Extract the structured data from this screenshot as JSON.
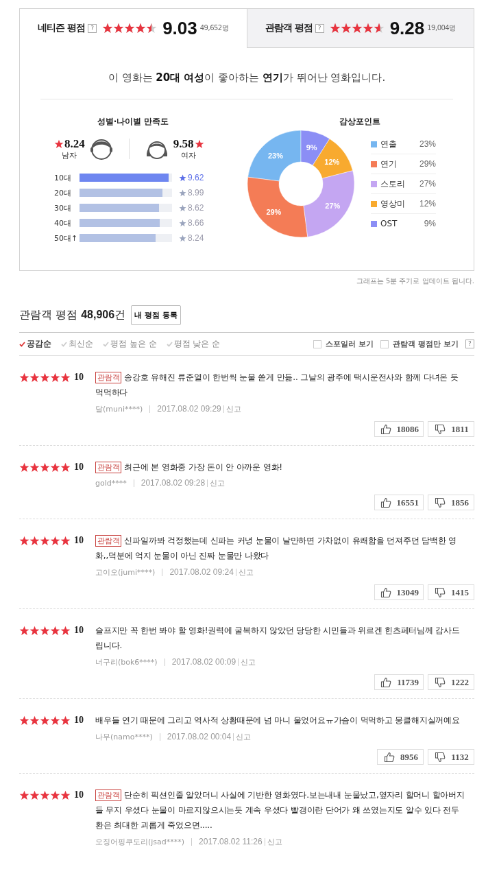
{
  "ratings": [
    {
      "label": "네티즌 평점",
      "help": "?",
      "stars": 4.5,
      "score": "9.03",
      "count": "49,652명",
      "selected": true
    },
    {
      "label": "관람객 평점",
      "help": "?",
      "stars": 4.6,
      "score": "9.28",
      "count": "19,004명",
      "selected": false
    }
  ],
  "summary": "이 영화는 **20대 여성**이 좋아하는 **연기**가 뛰어난 영화입니다.",
  "satisfaction": {
    "title": "성별·나이별 만족도",
    "genders": [
      {
        "kind": "male",
        "score": "8.24",
        "label": "남자"
      },
      {
        "kind": "female",
        "score": "9.58",
        "label": "여자"
      }
    ],
    "ages": [
      {
        "label": "10대",
        "level": 0.962,
        "score": "9.62",
        "highlighted": true
      },
      {
        "label": "20대",
        "level": 0.899,
        "score": "8.99",
        "highlighted": false
      },
      {
        "label": "30대",
        "level": 0.862,
        "score": "8.62",
        "highlighted": false
      },
      {
        "label": "40대",
        "level": 0.866,
        "score": "8.66",
        "highlighted": false
      },
      {
        "label": "50대↑",
        "level": 0.824,
        "score": "8.24",
        "highlighted": false
      }
    ]
  },
  "points": {
    "title": "감상포인트",
    "legend": [
      {
        "color": "#76b6f0",
        "value": "23%"
      },
      {
        "color": "#f47c56",
        "value": "29%"
      },
      {
        "color": "#c4a6f2",
        "value": "27%"
      },
      {
        "color": "#f8aa2f",
        "value": "12%"
      },
      {
        "color": "#8b8ef5",
        "value": "9%"
      }
    ],
    "chart_data": {
      "type": "donut",
      "categories": [
        "연출",
        "연기",
        "스토리",
        "영상미",
        "OST"
      ],
      "values": [
        23,
        29,
        27,
        12,
        9
      ],
      "value_labels": [
        "23%",
        "29%",
        "27%",
        "12%",
        "9%"
      ]
    }
  },
  "update_note": "그래프는 5분 주기로 업데이트 됩니다.",
  "reviews_header": {
    "title": "관람객 평점",
    "count": "48,906",
    "unit": "건",
    "button": "내 평점 등록"
  },
  "sort_options": [
    {
      "label": "공감순",
      "selected": true
    },
    {
      "label": "최신순",
      "selected": false
    },
    {
      "label": "평점 높은 순",
      "selected": false
    },
    {
      "label": "평점 낮은 순",
      "selected": false
    }
  ],
  "filters": [
    {
      "label": "스포일러 보기",
      "checked": false
    },
    {
      "label": "관람객 평점만 보기",
      "checked": false
    }
  ],
  "filter_help": "?",
  "reviews": [
    {
      "stars": 5,
      "score": "10",
      "badge": "관람객",
      "text": "송강호 유해진 류준열이 한번씩 눈물 쏟게 만듦.. 그날의 광주에 택시운전사와 함께 다녀온 듯 먹먹하다",
      "author": "달(muni****)",
      "date": "2017.08.02 09:29",
      "report": "신고",
      "likes": "18086",
      "dislikes": "1811"
    },
    {
      "stars": 5,
      "score": "10",
      "badge": "관람객",
      "text": "최근에 본 영화중 가장 돈이 안 아까운 영화!",
      "author": "gold****",
      "date": "2017.08.02 09:28",
      "report": "신고",
      "likes": "16551",
      "dislikes": "1856"
    },
    {
      "stars": 5,
      "score": "10",
      "badge": "관람객",
      "text": "신파일까봐 걱정했는데 신파는 커녕 눈물이 날만하면 가차없이 유쾌함을 던져주던 담백한 영화,,덕분에 억지 눈물이 아닌 진짜 눈물만 나왔다",
      "author": "고이오(jumi****)",
      "date": "2017.08.02 09:24",
      "report": "신고",
      "likes": "13049",
      "dislikes": "1415"
    },
    {
      "stars": 5,
      "score": "10",
      "text": "슬프지만 꼭 한번 봐야 할 영화!권력에 굴복하지 않았던 당당한 시민들과 위르겐 힌츠페터님께 감사드립니다.",
      "author": "너구리(bok6****)",
      "date": "2017.08.02 00:09",
      "report": "신고",
      "likes": "11739",
      "dislikes": "1222"
    },
    {
      "stars": 5,
      "score": "10",
      "text": "배우들 연기 때문에 그리고 역사적 상황때문에 넘 마니 울었어요ㅠ가슴이 먹먹하고 뭉클해지실꺼예요",
      "author": "나무(namo****)",
      "date": "2017.08.02 00:04",
      "report": "신고",
      "likes": "8956",
      "dislikes": "1132"
    },
    {
      "stars": 5,
      "score": "10",
      "badge": "관람객",
      "text": "단순히 픽션인줄 알았더니 사실에 기반한 영화였다.보는내내 눈물났고,옆자리 할머니 할아버지들 무지 우셨다 눈물이 마르지않으시는듯 계속 우셨다 빨갱이란 단어가 왜 쓰였는지도 알수 있다 전두환은 최대한 괴롭게 죽었으면.....",
      "author": "오징어핑쿠도리(jsad****)",
      "date": "2017.08.02 11:26",
      "report": "신고"
    }
  ]
}
